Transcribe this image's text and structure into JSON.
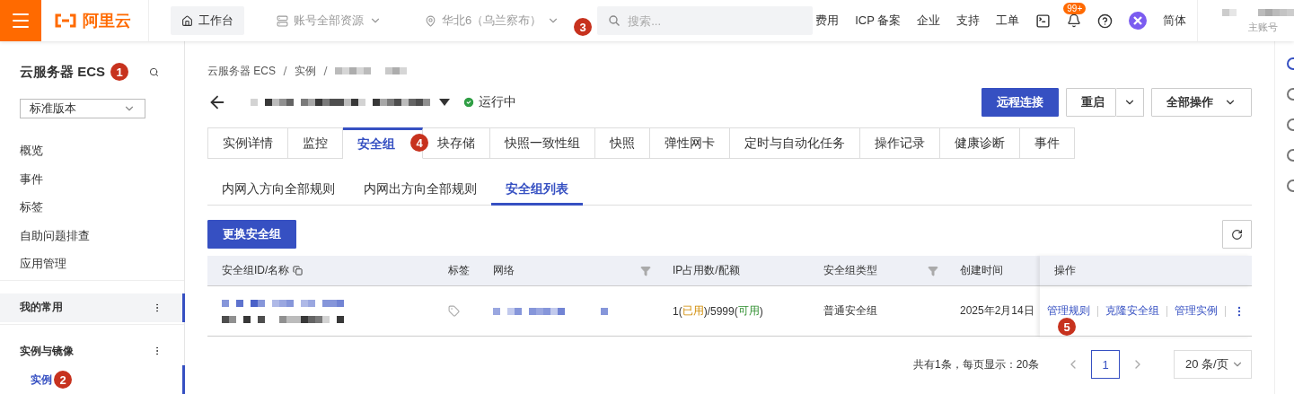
{
  "topbar": {
    "logo": "阿里云",
    "workbench": "工作台",
    "resource_scope": "账号全部资源",
    "region": {
      "label": "华北6（乌兰察布）",
      "badge": "3"
    },
    "search": {
      "placeholder": "搜索..."
    },
    "links": [
      "费用",
      "ICP 备案",
      "企业",
      "支持",
      "工单"
    ],
    "notification_count": "99+",
    "language": "简体",
    "account_role": "主账号"
  },
  "sidebar": {
    "title": "云服务器 ECS",
    "badge": "1",
    "version_select": "标准版本",
    "items": [
      "概览",
      "事件",
      "标签",
      "自助问题排查",
      "应用管理"
    ],
    "groups": [
      {
        "label": "我的常用",
        "highlighted": true
      },
      {
        "label": "实例与镜像",
        "highlighted": false,
        "children": [
          {
            "label": "实例",
            "selected": true,
            "badge": "2"
          }
        ]
      }
    ]
  },
  "main": {
    "breadcrumb": [
      "云服务器 ECS",
      "实例"
    ],
    "status": "运行中",
    "buttons": {
      "primary": "远程连接",
      "restart": "重启",
      "all_actions": "全部操作"
    },
    "tabs": [
      {
        "label": "实例详情",
        "selected": false
      },
      {
        "label": "监控",
        "selected": false
      },
      {
        "label": "安全组",
        "selected": true,
        "badge": "4"
      },
      {
        "label": "块存储",
        "selected": false
      },
      {
        "label": "快照一致性组",
        "selected": false
      },
      {
        "label": "快照",
        "selected": false
      },
      {
        "label": "弹性网卡",
        "selected": false
      },
      {
        "label": "定时与自动化任务",
        "selected": false
      },
      {
        "label": "操作记录",
        "selected": false
      },
      {
        "label": "健康诊断",
        "selected": false
      },
      {
        "label": "事件",
        "selected": false
      }
    ],
    "subtabs": [
      {
        "label": "内网入方向全部规则",
        "selected": false
      },
      {
        "label": "内网出方向全部规则",
        "selected": false
      },
      {
        "label": "安全组列表",
        "selected": true
      }
    ],
    "change_button": "更换安全组",
    "table": {
      "columns": [
        {
          "label": "安全组ID/名称",
          "filter": false
        },
        {
          "label": "标签",
          "filter": false
        },
        {
          "label": "网络",
          "filter": true
        },
        {
          "label": "IP占用数/配额",
          "filter": false
        },
        {
          "label": "安全组类型",
          "filter": true
        },
        {
          "label": "创建时间",
          "filter": false
        },
        {
          "label": "操作",
          "filter": false
        }
      ],
      "rows": [
        {
          "ip_usage": [
            {
              "text": "1(",
              "kind": "plain"
            },
            {
              "text": "已用",
              "kind": "used"
            },
            {
              "text": ")/5999(",
              "kind": "plain"
            },
            {
              "text": "可用",
              "kind": "free"
            },
            {
              "text": ")",
              "kind": "plain"
            }
          ],
          "type": "普通安全组",
          "created": "2025年2月14日",
          "actions": [
            {
              "label": "管理规则",
              "badge": "5"
            },
            {
              "label": "克隆安全组"
            },
            {
              "label": "管理实例"
            }
          ]
        }
      ]
    },
    "pagination": {
      "summary": "共有1条，每页显示：20条",
      "pages": [
        {
          "label": "1",
          "selected": true
        }
      ],
      "page_size": "20 条/页"
    }
  }
}
